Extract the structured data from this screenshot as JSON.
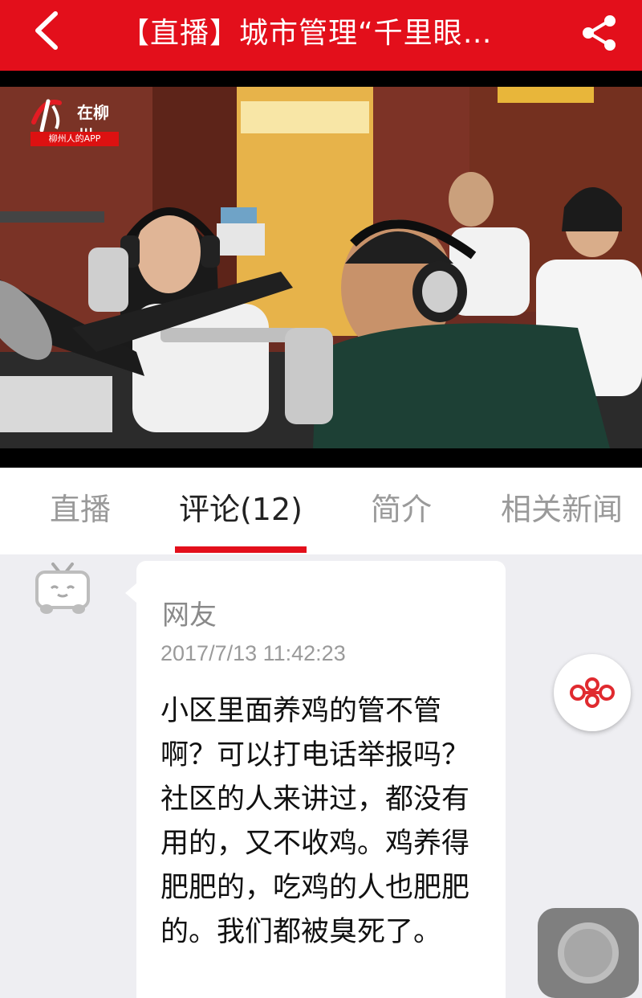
{
  "header": {
    "title": "【直播】城市管理“千里眼…",
    "back_icon": "back-chevron-icon",
    "share_icon": "share-icon",
    "color": "#e30f1b"
  },
  "video": {
    "logo_text": "在柳州",
    "logo_subtitle": "柳州人的APP"
  },
  "tabs": [
    {
      "label": "直播",
      "active": false
    },
    {
      "label": "评论(12)",
      "active": true
    },
    {
      "label": "简介",
      "active": false
    },
    {
      "label": "相关新闻",
      "active": false
    }
  ],
  "comment": {
    "username": "网友",
    "timestamp": "2017/7/13 11:42:23",
    "text": "小区里面养鸡的管不管啊？可以打电话举报吗？社区的人来讲过，都没有用的，又不收鸡。鸡养得肥肥的，吃鸡的人也肥肥的。我们都被臭死了。",
    "avatar_icon": "tv-avatar-icon"
  },
  "floating": {
    "badge_icon": "china-unicom-knot-icon",
    "assistive_icon": "assistive-touch-icon"
  }
}
